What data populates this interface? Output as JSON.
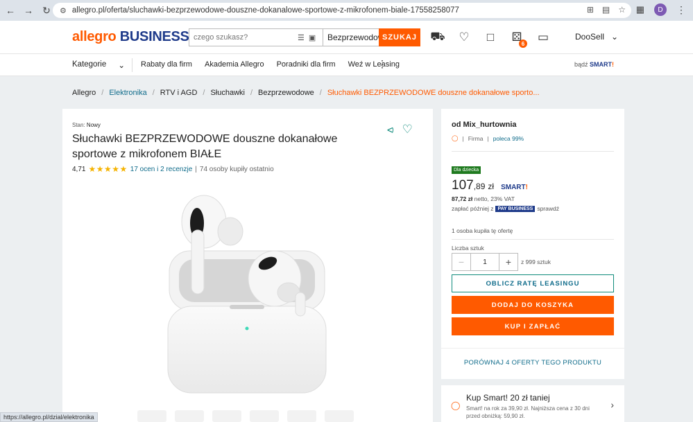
{
  "browser": {
    "url": "allegro.pl/oferta/sluchawki-bezprzewodowe-douszne-dokanalowe-sportowe-z-mikrofonem-biale-17558258077",
    "profile_initial": "D",
    "status_url": "https://allegro.pl/dzial/elektronika"
  },
  "header": {
    "logo_allegro": "allegro",
    "logo_business": "BUSINESS",
    "search_placeholder": "czego szukasz?",
    "search_category": "Bezprzewodowe",
    "search_button": "SZUKAJ",
    "notifications_count": "6",
    "user_name": "DooSell"
  },
  "catbar": {
    "categories_label": "Kategorie",
    "links": [
      "Rabaty dla firm",
      "Akademia Allegro",
      "Poradniki dla firm",
      "Weź w Leasing"
    ],
    "smart_prefix": "bądź",
    "smart_label": "SMART",
    "smart_mark": "!"
  },
  "breadcrumb": [
    "Allegro",
    "Elektronika",
    "RTV i AGD",
    "Słuchawki",
    "Bezprzewodowe",
    "Słuchawki BEZPRZEWODOWE douszne dokanałowe sporto..."
  ],
  "product": {
    "condition_label": "Stan:",
    "condition_value": "Nowy",
    "title": "Słuchawki BEZPRZEWODOWE douszne dokanałowe sportowe z mikrofonem BIAŁE",
    "rating_value": "4,71",
    "stars": 5,
    "reviews": "17 ocen i 2 recenzje",
    "bought_recently": "74 osoby kupiły ostatnio"
  },
  "offer": {
    "seller": "od Mix_hurtownia",
    "seller_type": "Firma",
    "recommend": "poleca 99%",
    "kid_badge": "Dla dziecka",
    "price_main": "107",
    "price_cents": ",89",
    "price_currency": "zł",
    "smart_label": "SMART",
    "smart_mark": "!",
    "netto_price": "87,72 zł",
    "netto_suffix": "netto, 23% VAT",
    "pay_later_prefix": "zapłać później z",
    "pay_business": "PAY BUSINESS",
    "pay_later_suffix": "sprawdź",
    "buyers": "1 osoba kupiła tę ofertę",
    "qty_label": "Liczba sztuk",
    "qty_value": "1",
    "qty_of": "z 999 sztuk",
    "lease_button": "OBLICZ RATĘ LEASINGU",
    "cart_button": "DODAJ DO KOSZYKA",
    "buy_button": "KUP I ZAPŁAĆ",
    "compare_link": "PORÓWNAJ 4 OFERTY TEGO PRODUKTU"
  },
  "promo": {
    "title": "Kup Smart! 20 zł taniej",
    "text": "Smart! na rok za 39,90 zł. Najniższa cena z 30 dni przed obniżką: 59,90 zł."
  },
  "colors": {
    "brand_orange": "#ff5a00",
    "brand_navy": "#1e3a8a",
    "teal_link": "#0e6b8a",
    "kid_green": "#1f7a1f"
  },
  "icons": [
    "back-icon",
    "forward-icon",
    "reload-icon",
    "site-info-icon",
    "install-icon",
    "translate-icon",
    "star-icon",
    "extensions-icon",
    "camera-search-icon",
    "chevron-down-icon",
    "truck-icon",
    "heart-icon",
    "chat-icon",
    "bell-icon",
    "bag-icon",
    "more-vertical-icon",
    "share-icon",
    "favorite-icon",
    "seller-icon",
    "chevron-right-icon"
  ]
}
